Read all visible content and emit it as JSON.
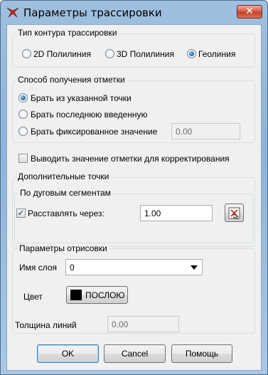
{
  "window": {
    "title": "Параметры трассировки",
    "close_label": "✕"
  },
  "contour_type": {
    "legend": "Тип контура трассировки",
    "options": [
      "2D Полилиния",
      "3D Полилиния",
      "Геолиния"
    ],
    "selected": "Геолиния"
  },
  "mark_method": {
    "legend": "Способ получения отметки",
    "options": [
      "Брать из указанной точки",
      "Брать последнюю введенную",
      "Брать фиксированное значение"
    ],
    "selected": "Брать из указанной точки",
    "fixed_value": "0.00"
  },
  "output_mark": {
    "label": "Выводить значение отметки для корректирования",
    "checked": false
  },
  "extra_points": {
    "legend": "Дополнительные точки",
    "arc_segments": {
      "legend": "По дуговым сегментам",
      "place_label": "Расставлять через:",
      "place_checked": true,
      "value": "1.00"
    }
  },
  "render_params": {
    "legend": "Параметры отрисовки",
    "layer_label": "Имя слоя",
    "layer_value": "0",
    "color_label": "Цвет",
    "color_button_label": "ПОСЛОЮ",
    "color_swatch": "#000000",
    "line_width_label": "Толщина линий",
    "line_width_value": "0.00"
  },
  "buttons": {
    "ok": "OK",
    "cancel": "Cancel",
    "help": "Помощь"
  }
}
